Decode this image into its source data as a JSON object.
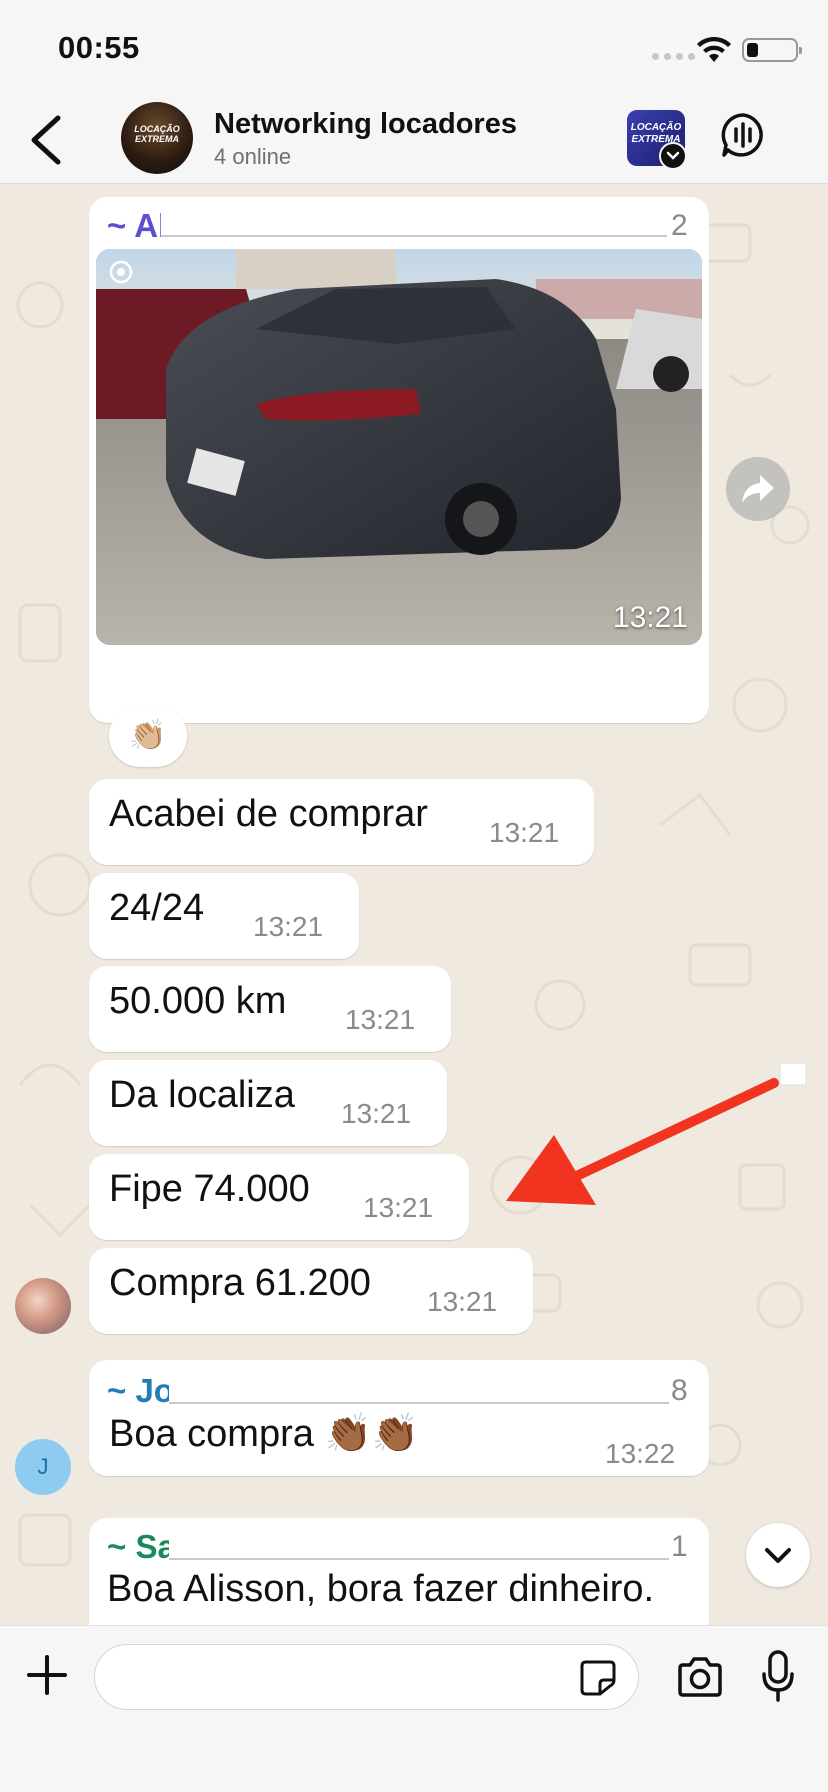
{
  "status_bar": {
    "time": "00:55"
  },
  "header": {
    "title": "Networking locadores",
    "subtitle": "4 online",
    "avatar_text": "LOCAÇÃO EXTREMA",
    "community_text": "LOCAÇÃO EXTREMA"
  },
  "messages": [
    {
      "sender_prefix": "~ Al",
      "sender_trailing": "2",
      "photo_time": "13:21",
      "reaction": "👏🏼"
    },
    {
      "text": "Acabei de comprar",
      "time": "13:21"
    },
    {
      "text": "24/24",
      "time": "13:21"
    },
    {
      "text": "50.000 km",
      "time": "13:21"
    },
    {
      "text": "Da localiza",
      "time": "13:21"
    },
    {
      "text": "Fipe 74.000",
      "time": "13:21"
    },
    {
      "text": "Compra 61.200",
      "time": "13:21"
    },
    {
      "sender_prefix": "~ Jo",
      "sender_trailing": "8",
      "text": "Boa compra 👏🏾👏🏾",
      "time": "13:22",
      "avatar_initial": "J"
    },
    {
      "sender_prefix": "~ Sa",
      "sender_trailing": "1",
      "text": "Boa Alisson, bora fazer dinheiro."
    }
  ],
  "composer": {
    "placeholder": ""
  },
  "colors": {
    "sender_1": "#5b4fd1",
    "sender_2": "#1f7fb4",
    "sender_3": "#1b8a5a",
    "arrow": "#f0341f"
  }
}
